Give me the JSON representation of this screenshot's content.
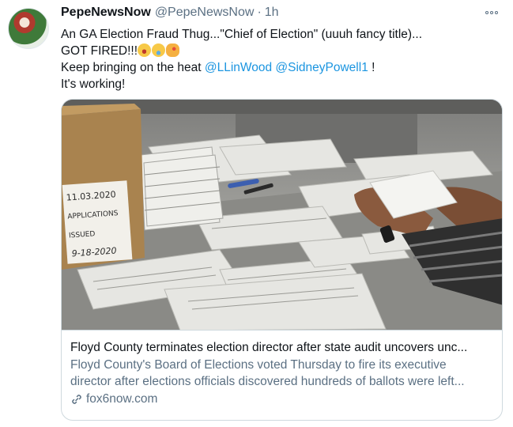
{
  "tweet": {
    "display_name": "PepeNewsNow",
    "handle": "@PepeNewsNow",
    "separator": "·",
    "time": "1h",
    "text": {
      "line1": "An GA  Election Fraud Thug...\"Chief of Election\" (uuuh  fancy title)...",
      "line2": "GOT FIRED!!!",
      "line3_prefix": "Keep bringing on the heat ",
      "mention1": "@LLinWood",
      "line3_space": " ",
      "mention2": "@SidneyPowell1",
      "line3_suffix": " !",
      "line4": "It's working!"
    },
    "emojis": [
      "flushed-face-emoji",
      "tears-of-joy-emoji",
      "party-face-emoji"
    ],
    "colors": {
      "name": "#0f1419",
      "secondary": "#5b7083",
      "link": "#1b95e0"
    }
  },
  "card": {
    "image_text": [
      "11.03.2020",
      "APPLICATIONS",
      "ISSUED",
      "9-18-2020"
    ],
    "title": "Floyd County terminates election director after state audit uncovers unc...",
    "description_line1": "Floyd County's Board of Elections voted Thursday to fire its executive",
    "description_line2": "director after elections officials discovered hundreds of ballots were left...",
    "domain": "fox6now.com"
  }
}
